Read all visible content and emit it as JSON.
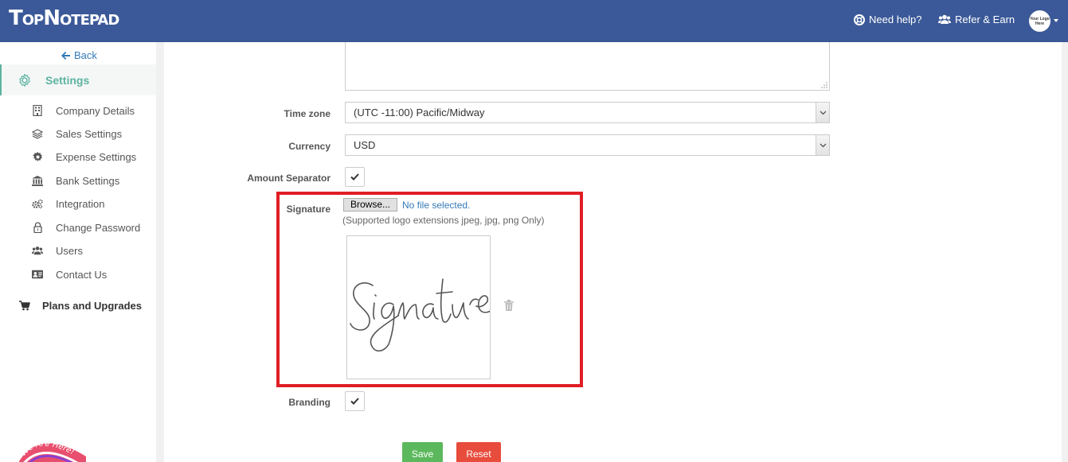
{
  "header": {
    "logo": "TopNotepad",
    "help_label": "Need help?",
    "refer_label": "Refer & Earn",
    "avatar_text": "Your Logo Here"
  },
  "sidebar": {
    "back_label": "Back",
    "settings_label": "Settings",
    "items": [
      {
        "label": "Company Details",
        "icon": "building-icon"
      },
      {
        "label": "Sales Settings",
        "icon": "layers-icon"
      },
      {
        "label": "Expense Settings",
        "icon": "gear-icon"
      },
      {
        "label": "Bank Settings",
        "icon": "bank-icon"
      },
      {
        "label": "Integration",
        "icon": "cogs-icon"
      },
      {
        "label": "Change Password",
        "icon": "lock-icon"
      },
      {
        "label": "Users",
        "icon": "users-icon"
      },
      {
        "label": "Contact Us",
        "icon": "contact-card-icon"
      }
    ],
    "plans_label": "Plans and Upgrades",
    "badge_text": "We Are Here!"
  },
  "form": {
    "timezone_label": "Time zone",
    "timezone_value": "(UTC -11:00) Pacific/Midway",
    "currency_label": "Currency",
    "currency_value": "USD",
    "amount_separator_label": "Amount Separator",
    "amount_separator_checked": true,
    "signature_label": "Signature",
    "browse_label": "Browse...",
    "no_file_label": "No file selected.",
    "supported_text": "(Supported logo extensions jpeg, jpg, png Only)",
    "branding_label": "Branding",
    "branding_checked": true,
    "save_label": "Save",
    "reset_label": "Reset"
  },
  "colors": {
    "header_bg": "#3b5998",
    "accent": "#5cb3a0",
    "highlight_border": "#e01e25",
    "save_bg": "#5cb85c",
    "reset_bg": "#e74c3c"
  }
}
